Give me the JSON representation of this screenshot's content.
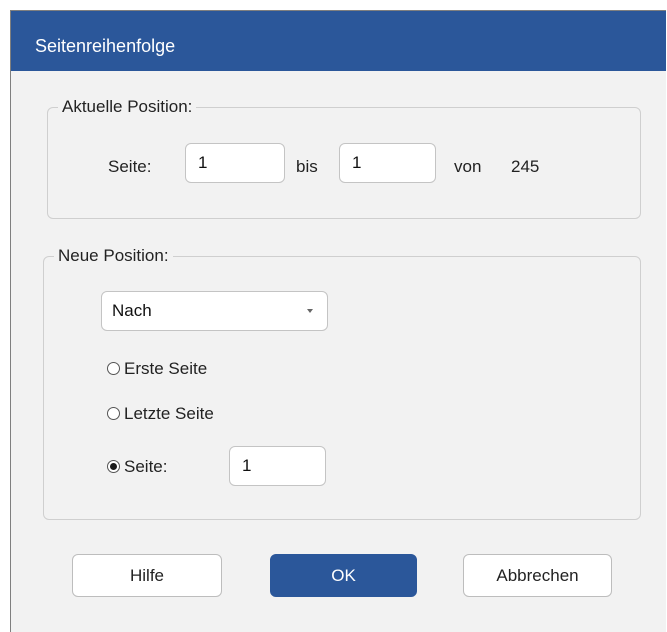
{
  "window": {
    "title": "Seitenreihenfolge"
  },
  "current_position": {
    "legend": "Aktuelle Position:",
    "page_label": "Seite:",
    "from_value": "1",
    "to_label": "bis",
    "to_value": "1",
    "of_label": "von",
    "total_pages": "245"
  },
  "new_position": {
    "legend": "Neue Position:",
    "placement_selected": "Nach",
    "radio_first_page": "Erste Seite",
    "radio_last_page": "Letzte Seite",
    "radio_page": "Seite:",
    "selected_radio": "page",
    "page_value": "1"
  },
  "buttons": {
    "help": "Hilfe",
    "ok": "OK",
    "cancel": "Abbrechen"
  },
  "colors": {
    "accent": "#2b579a",
    "dialog_background": "#f2f2f2"
  },
  "icons": {
    "dropdown": "chevron-down-icon",
    "radio_selected": "radio-selected-icon",
    "radio_unselected": "radio-unselected-icon"
  }
}
